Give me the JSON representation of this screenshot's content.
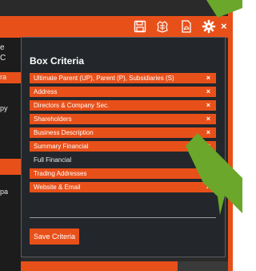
{
  "colors": {
    "accent": "#e8501a",
    "modal_bg": "#23272b",
    "page_dark": "#2a2a2a",
    "highlight_green": "#6aa72a"
  },
  "background": {
    "left_fragments": [
      "e",
      "C",
      "ra",
      "py",
      "pa"
    ]
  },
  "toolbar": {
    "icons": [
      "save-icon",
      "crest-icon",
      "pdf-icon",
      "gear-icon"
    ],
    "close_label": "×"
  },
  "modal": {
    "title": "Box Criteria",
    "criteria": [
      {
        "label": "Ultimate Parent (UP), Parent (P), Subsidiaries (S)",
        "selected": true
      },
      {
        "label": "Address",
        "selected": true
      },
      {
        "label": "Directors & Company Sec.",
        "selected": true
      },
      {
        "label": "Shareholders",
        "selected": true
      },
      {
        "label": "Business Description",
        "selected": true
      },
      {
        "label": "Summary Financial",
        "selected": true
      },
      {
        "label": "Full Financial",
        "selected": false
      },
      {
        "label": "Trading Addresses",
        "selected": true
      },
      {
        "label": "Website & Email",
        "selected": true
      }
    ],
    "remove_label": "×",
    "save_label": "Save Criteria"
  }
}
